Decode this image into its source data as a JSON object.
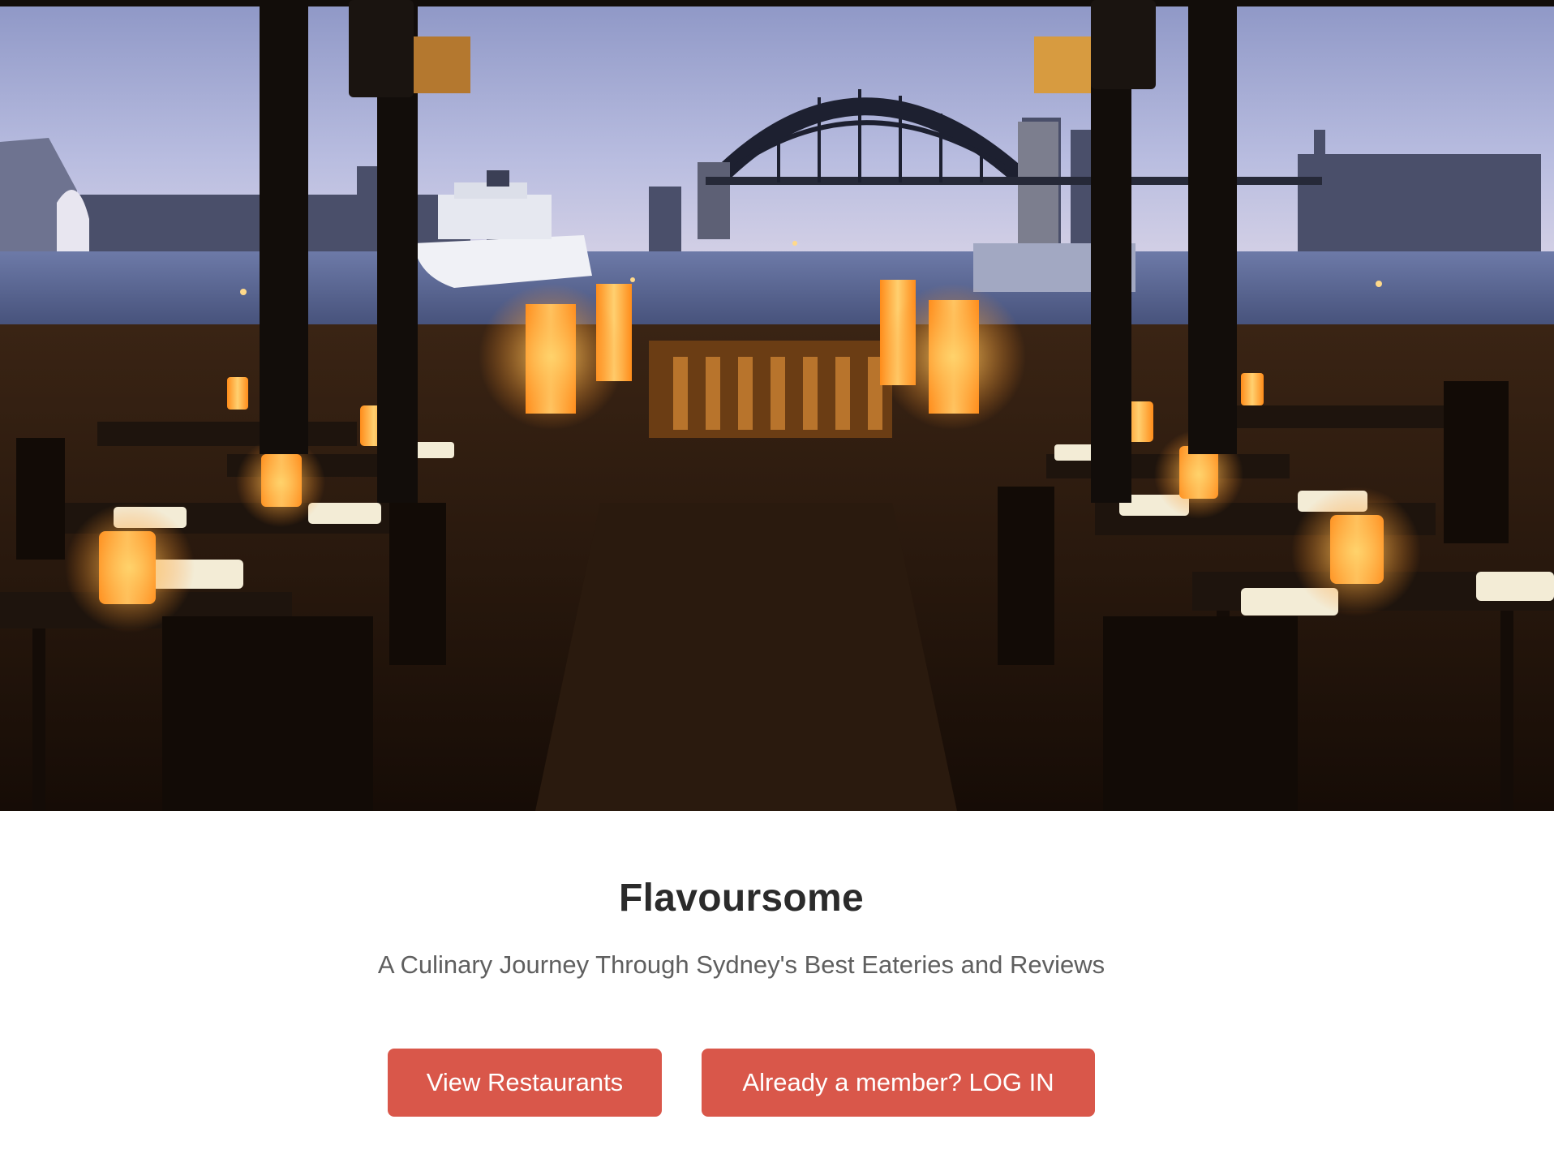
{
  "hero": {
    "image_name": "restaurant-harbour-night-photo"
  },
  "main": {
    "title": "Flavoursome",
    "subtitle": "A Culinary Journey Through Sydney's Best Eateries and Reviews",
    "buttons": {
      "view_restaurants": "View Restaurants",
      "login": "Already a member? LOG IN"
    }
  },
  "colors": {
    "accent": "#d9574a",
    "title": "#2b2b2b",
    "subtitle": "#5f5f5f",
    "background": "#ffffff"
  }
}
